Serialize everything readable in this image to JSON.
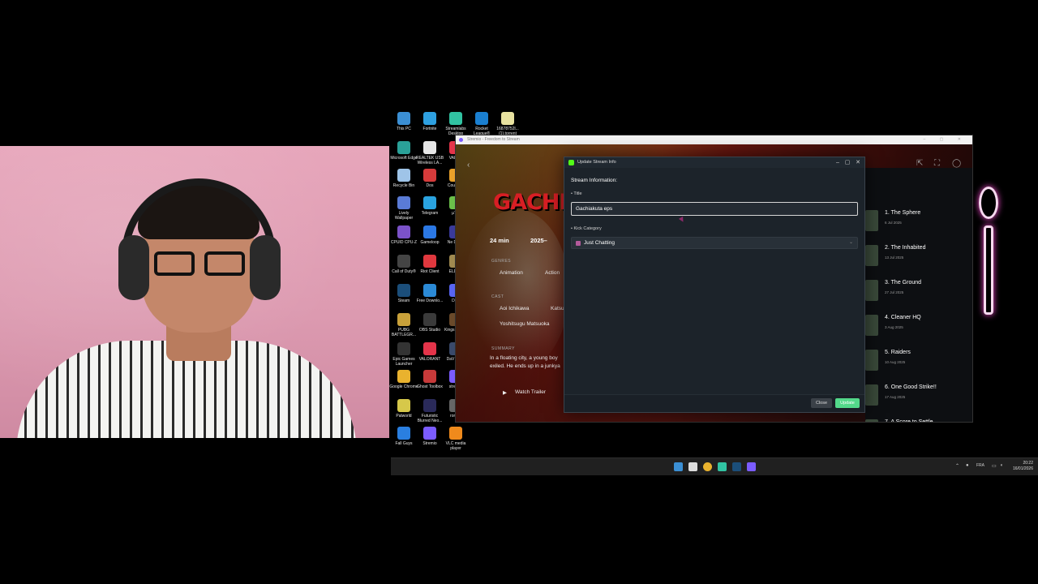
{
  "desktop": {
    "icons": [
      {
        "label": "This PC",
        "color": "#3b8fd4"
      },
      {
        "label": "Fortnite",
        "color": "#2ea0e0"
      },
      {
        "label": "Streamlabs Desktop",
        "color": "#31c3a2"
      },
      {
        "label": "Rocket League®",
        "color": "#1a7fd0"
      },
      {
        "label": "16878752l... (1).torrent",
        "color": "#e8e2a0"
      },
      {
        "label": "Microsoft Edge",
        "color": "#2aa198"
      },
      {
        "label": "REALTEK USB Wireless LA...",
        "color": "#e6e6e6"
      },
      {
        "label": "VALOR",
        "color": "#e4344a"
      },
      {
        "label": "Recycle Bin",
        "color": "#9fc4e8"
      },
      {
        "label": "Dos",
        "color": "#d63b3b"
      },
      {
        "label": "Counte 2",
        "color": "#e8a02a"
      },
      {
        "label": "Lively Wallpaper",
        "color": "#5a7bd6"
      },
      {
        "label": "Telegram",
        "color": "#2aa3e0"
      },
      {
        "label": "µTor",
        "color": "#6bbf4a"
      },
      {
        "label": "CPUID CPU-Z",
        "color": "#7b52c9"
      },
      {
        "label": "Gameloop",
        "color": "#2b78e4"
      },
      {
        "label": "Ne Down",
        "color": "#3a3a9a"
      },
      {
        "label": "Call of Duty®",
        "color": "#444"
      },
      {
        "label": "Riot Client",
        "color": "#e0383e"
      },
      {
        "label": "ELDEN",
        "color": "#a08a50"
      },
      {
        "label": "Steam",
        "color": "#1b4e7a"
      },
      {
        "label": "Free Downlo...",
        "color": "#2b8ad6"
      },
      {
        "label": "Disc",
        "color": "#5865f2"
      },
      {
        "label": "PUBG BATTLEGR...",
        "color": "#c9a13a"
      },
      {
        "label": "OBS Studio",
        "color": "#3a3a3a"
      },
      {
        "label": "Kings Two C",
        "color": "#6a4a2a"
      },
      {
        "label": "Epic Games Launcher",
        "color": "#333"
      },
      {
        "label": "VALORANT",
        "color": "#e4344a"
      },
      {
        "label": "DaV Reso",
        "color": "#3a4a6a"
      },
      {
        "label": "Google Chrome",
        "color": "#e9b22e"
      },
      {
        "label": "Ghost Toolbox",
        "color": "#c83a3a"
      },
      {
        "label": "stremio",
        "color": "#7b5cff"
      },
      {
        "label": "Palworld",
        "color": "#d6c84a"
      },
      {
        "label": "Futuristic Blurred Neo...",
        "color": "#2a2a5a"
      },
      {
        "label": "ronald",
        "color": "#666"
      },
      {
        "label": "Fall Guys",
        "color": "#2a7fe0"
      },
      {
        "label": "Stremio",
        "color": "#7b5cff"
      },
      {
        "label": "VLC media player",
        "color": "#f08a1c"
      },
      {
        "label": "Gotham Knights",
        "color": "#5a5a6a"
      }
    ]
  },
  "taskbar": {
    "language": "FRA",
    "time": "20:22",
    "date": "16/01/2026"
  },
  "app": {
    "window_title": "Stremio - Freedom to Stream",
    "show_title": "GACHIAK",
    "runtime": "24 min",
    "year": "2025–",
    "genres_label": "GENRES",
    "genres": [
      "Animation",
      "Action"
    ],
    "cast_label": "CAST",
    "cast": [
      "Aoi Ichikawa",
      "Katsu",
      "Yoshitsugu Matsuoka"
    ],
    "summary_label": "SUMMARY",
    "summary_lines": [
      "In a floating city, a young boy",
      "exiled. He ends up in a junkya"
    ],
    "watch_trailer": "Watch Trailer",
    "episodes": [
      {
        "name": "1. The Sphere",
        "date": "6 Jul 2025"
      },
      {
        "name": "2. The Inhabited",
        "date": "13 Jul 2025"
      },
      {
        "name": "3. The Ground",
        "date": "27 Jul 2025"
      },
      {
        "name": "4. Cleaner HQ",
        "date": "3 Aug 2025"
      },
      {
        "name": "5. Raiders",
        "date": "10 Aug 2025"
      },
      {
        "name": "6. One Good Strike!!",
        "date": "17 Aug 2025"
      },
      {
        "name": "7. A Score to Settle",
        "date": ""
      }
    ]
  },
  "dialog": {
    "window_title": "Update Stream Info",
    "heading": "Stream Information:",
    "title_label": "• Title",
    "title_value": "Gachiakuta eps",
    "category_label": "• Kick Category",
    "category_value": "Just Chatting",
    "close_label": "Close",
    "update_label": "Update"
  }
}
